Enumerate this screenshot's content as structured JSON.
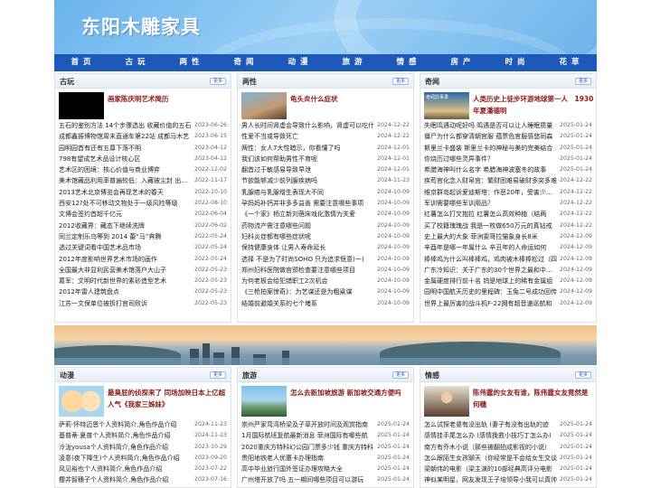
{
  "site": {
    "title": "东阳木雕家具"
  },
  "nav": [
    "首 页",
    "古 玩",
    "两 性",
    "奇 闻",
    "动 漫",
    "旅 游",
    "情 感",
    "房 产",
    "时 尚",
    "花 草"
  ],
  "more_label": "更多",
  "panels": [
    {
      "title": "古玩",
      "feature": "画家陈庆明艺术简历",
      "items": [
        [
          "五石的鉴别方法 14个步骤选出 收藏价值的五石",
          "2023-06-26"
        ],
        [
          "成都鑫振博物馆周末直通车第22站 成都马木艺",
          "2023-06-15"
        ],
        [
          "园明园首有还有五尊下落不明",
          "2023-04-12"
        ],
        [
          "798有望成艺术品设计核心区",
          "2023-04-12"
        ],
        [
          "艺术区的困境：核心价值与商业博弈",
          "2022-12-02"
        ],
        [
          "美术馆藏品利用率普遍较低：入藏被尘封 出镜率",
          "2022-11-17"
        ],
        [
          "2013艺术北京博览会再现艺术的春天",
          "2022-10-10"
        ],
        [
          "西安12?处不可移动文物处于一级风险等级",
          "2022-08-10"
        ],
        [
          "文博会签约首超千亿元",
          "2022-06-04"
        ],
        [
          "2012收藏界：藏态下继续洗牌",
          "2022-06-02"
        ],
        [
          "同兰定制乐乌等到 2014 蕾“马”奔腾",
          "2022-05-24"
        ],
        [
          "透过关键词看中国艺术品市场",
          "2022-05-24"
        ],
        [
          "2012年度影响世界艺术市场的画作",
          "2022-05-24"
        ],
        [
          "全国最大非显利民营美术馆落户大山子",
          "2022-05-23"
        ],
        [
          "葛军：文明时代新世界的素砂造型艺术",
          "2022-05-23"
        ],
        [
          "2012年雷人建筑盘点",
          "2022-05-23"
        ],
        [
          "江苏一文保单位被拆打官司败诉",
          "2022-05-23"
        ]
      ]
    },
    {
      "title": "两性",
      "feature": "龟头炎什么症状",
      "items": [
        [
          "男人长时间肾虚会导致什么影响，肾虚可以吃什",
          "2024-12-22"
        ],
        [
          "性爱不当或导致死亡",
          "2024-12-22"
        ],
        [
          "两性：女人7大性暗示，你看懂了吗",
          "2024-12-01"
        ],
        [
          "我们该如何帮助男性不育呢",
          "2024-12-01"
        ],
        [
          "翻首过于敏感易导致早泄",
          "2024-12-01"
        ],
        [
          "节欲能够减少前列腺疾病吗",
          "2024-11-23"
        ],
        [
          "乳腺癌与乳腺增生表现大不同",
          "2024-10-09"
        ],
        [
          "孕妈妈补钙并非多多益善 需要注意哪些事项",
          "2024-10-09"
        ],
        [
          "《一个家》杨立新刘蓓床戏化激情为关爱",
          "2024-10-09"
        ],
        [
          "药物流产需注意哪些问题",
          "2024-10-09"
        ],
        [
          "妇科炎症都有哪些症状呢",
          "2024-10-09"
        ],
        [
          "保持健康身体 让男人寿命延长",
          "2024-10-09"
        ],
        [
          "选择 不是为了时尚SOHO 只为追求惬意(一)",
          "2024-10-09"
        ],
        [
          "郑州妇科医院做宫颈检查要注意哪些项目",
          "2024-10-09"
        ],
        [
          "为何老板会给犯错职工2次机会",
          "2024-10-09"
        ],
        [
          "《三枪拍案惊奇》：为艺谋还是为粗粱谋",
          "2024-10-09"
        ],
        [
          "结婚前避婚关系的七个堵系",
          "2024-10-09"
        ]
      ]
    },
    {
      "title": "奇闻",
      "feature": "人类历史上徒步环游地球第一人　1930年夏潘德明",
      "thumb_tag": "奇闻异事录",
      "items": [
        [
          "失眠鸣遇动呢好吗 鸣遇是否可以让人睡眠质量",
          "2025-01-24"
        ],
        [
          "僵尸为什么都穿清朝官服 蕴票色官服感悠同森",
          "2025-01-24"
        ],
        [
          "斯里兰卡盛装 斯里兰卡的神秘与美的完美结合",
          "2025-01-24"
        ],
        [
          "你烧历过哪些灵异事件？",
          "2025-01-24"
        ],
        [
          "希腊海神叫什么名字 希腊海神波塞冬的故事",
          "2025-01-24"
        ],
        [
          "疾苟官化念入财帛宫：繁财困难易破财多突多难",
          "2024-12-22"
        ],
        [
          "维京群岛起诉爱迪斯塔：作恶20年，受害少女数",
          "2024-12-22"
        ],
        [
          "军训需要哪些军训用品？",
          "2024-12-22"
        ],
        [
          "红薯怎么打叉抱拉 红薯怎么高效种植（结两",
          "2024-12-22"
        ],
        [
          "买了校籍瑰瑰战 我是一枚做650万元的真钻戒",
          "2024-12-22"
        ],
        [
          "史上最大的大象 菲洲雯哥拉猫象身长8米",
          "2024-12-09"
        ],
        [
          "辛酉年是哪一年属什么 辛丑年的人命运如何",
          "2024-12-09"
        ],
        [
          "捧棒鸡为什么叫棒棒鸡，鸡肉被木棒捧松过（四",
          "2024-12-09"
        ],
        [
          "广东冷知识：关于广东的30个世界之最和中国之",
          "2024-12-09"
        ],
        [
          "金属硬度排行前十名 钨是地球上的稀有金属组",
          "2024-12-09"
        ],
        [
          "园明中国航天历史的里程碑：玉兔二号成功回传",
          "2024-12-09"
        ],
        [
          "世界上最厉害的战斗机F-22拥有超音速巡航和",
          "2024-12-09"
        ]
      ]
    },
    {
      "title": "动漫",
      "feature": "最臭屁的侦探来了 同场加映日本上亿超人气《我家三姊妹》",
      "items": [
        [
          "萨莉·怀特迈恩个人资料简介,角色作品介绍",
          "2024-11-23"
        ],
        [
          "基普蒂·夏普个人资料简介,角色作品介绍",
          "2024-11-23"
        ],
        [
          "泠泷yousa个人资料简介,角色作品介绍",
          "2023-10-29"
        ],
        [
          "凌意(夜下降生)个人资料简介,角色作品介绍",
          "2023-09-20"
        ],
        [
          "风见裕也个人资料简介,角色作品介绍",
          "2023-07-22"
        ],
        [
          "樱井智穗子个人资料简介,角色作品介绍",
          "2023-07-16"
        ]
      ]
    },
    {
      "title": "旅游",
      "feature": "怎么去新加坡旅游 新加坡交通方便吗",
      "items": [
        [
          "崇州严家弯湾桥梁及子草开放时间及观赏指南",
          "2025-01-24"
        ],
        [
          "1月国际航班复航最新消息 菲洲国际有哪些航",
          "2025-01-24"
        ],
        [
          "2020重庆方特科幻公园门票多少钱 重庆方特科",
          "2025-01-24"
        ],
        [
          "贵阳地铁老人优惠卡办理指南",
          "2025-01-24"
        ],
        [
          "高中毕业旅行国外签证办理攻略大全",
          "2025-01-24"
        ],
        [
          "广州塔开放了吗 五一期间哪些项目可以游玩",
          "2025-01-24"
        ]
      ]
    },
    {
      "title": "情感",
      "feature": "陈伟霆的女友有谁，陈伟霆女友竟然是何穗",
      "items": [
        [
          "怎么试探老婆有没出轨 (妻子有没有出轨的迹",
          "2025-01-24"
        ],
        [
          "感情挂手尾怎么办 (感情挽救小技巧丁怎么办)",
          "2025-01-24"
        ],
        [
          "南方有乔木小说（那些被翻拍成影视的小说）",
          "2025-01-24"
        ],
        [
          "怎么跟陌生女孩聊天（你经常是不会给女生交谈",
          "2025-01-24"
        ],
        [
          "梁朝伟的电影（梁主演的10部经典高评分电影",
          "2025-01-24"
        ],
        [
          "神似某明星，网友发现王子培领导小我可以真帅",
          "2025-01-24"
        ]
      ]
    }
  ]
}
